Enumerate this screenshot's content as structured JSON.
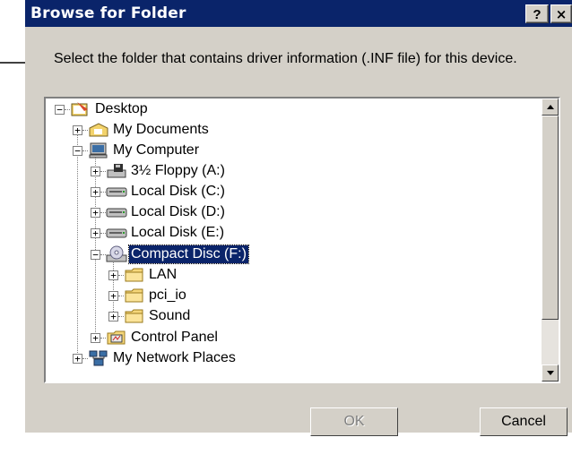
{
  "window": {
    "title": "Browse for Folder",
    "help_label": "?",
    "close_label": "×"
  },
  "instruction": "Select the folder that contains driver information (.INF file) for this device.",
  "tree": {
    "items": [
      {
        "label": "Desktop",
        "icon": "desktop-icon",
        "expander": "−"
      },
      {
        "label": "My Documents",
        "icon": "my-documents-icon",
        "expander": "+"
      },
      {
        "label": "My Computer",
        "icon": "my-computer-icon",
        "expander": "−"
      },
      {
        "label": "3½ Floppy (A:)",
        "icon": "floppy-drive-icon",
        "expander": "+"
      },
      {
        "label": "Local Disk (C:)",
        "icon": "hard-disk-icon",
        "expander": "+"
      },
      {
        "label": "Local Disk (D:)",
        "icon": "hard-disk-icon",
        "expander": "+"
      },
      {
        "label": "Local Disk (E:)",
        "icon": "hard-disk-icon",
        "expander": "+"
      },
      {
        "label": "Compact Disc (F:)",
        "icon": "cd-drive-icon",
        "expander": "−",
        "selected": true
      },
      {
        "label": "LAN",
        "icon": "folder-icon",
        "expander": "+"
      },
      {
        "label": "pci_io",
        "icon": "folder-icon",
        "expander": "+"
      },
      {
        "label": "Sound",
        "icon": "folder-icon",
        "expander": "+"
      },
      {
        "label": "Control Panel",
        "icon": "control-panel-icon",
        "expander": "+"
      },
      {
        "label": "My Network Places",
        "icon": "network-places-icon",
        "expander": "+"
      }
    ]
  },
  "buttons": {
    "ok_label": "OK",
    "ok_enabled": false,
    "cancel_label": "Cancel"
  },
  "colors": {
    "titlebar": "#0a246a",
    "dialog_face": "#d4d0c8",
    "selection": "#0a246a"
  }
}
